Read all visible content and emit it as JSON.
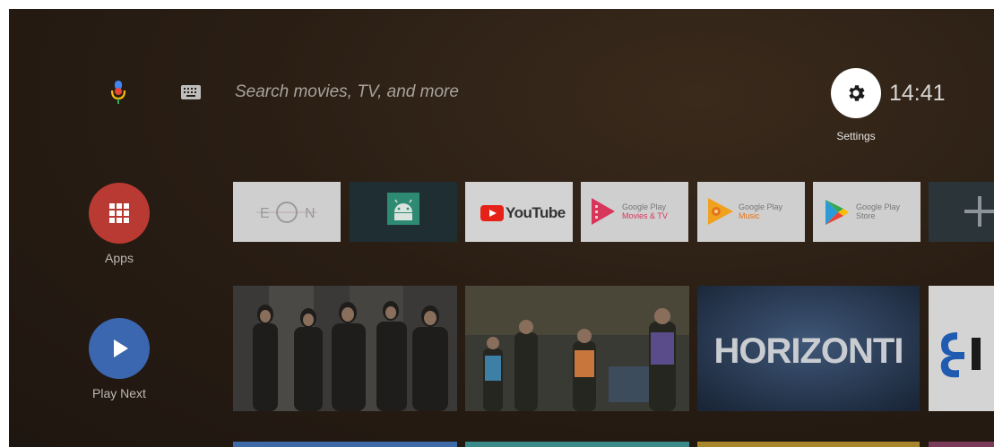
{
  "search": {
    "placeholder": "Search movies, TV, and more"
  },
  "header": {
    "settings_label": "Settings",
    "clock": "14:41"
  },
  "sidebar": {
    "apps_label": "Apps",
    "play_next_label": "Play Next"
  },
  "apps_row": {
    "tiles": [
      {
        "name": "EON",
        "logo_text": "E O N"
      },
      {
        "name": "Android"
      },
      {
        "name": "YouTube",
        "logo_text": "YouTube"
      },
      {
        "name": "Google Play Movies & TV",
        "line1": "Google Play",
        "line2": "Movies & TV"
      },
      {
        "name": "Google Play Music",
        "line1": "Google Play",
        "line2": "Music"
      },
      {
        "name": "Google Play Store",
        "line1": "Google Play",
        "line2": "Store"
      },
      {
        "name": "Add"
      }
    ]
  },
  "media_row": {
    "items": [
      {
        "name": "show-cast"
      },
      {
        "name": "family-sitcom"
      },
      {
        "name": "horizonti",
        "title": "HORIZONTI"
      },
      {
        "name": "euroleague"
      }
    ]
  },
  "colors": {
    "accent_red": "#b83a32",
    "accent_blue": "#3b66b0",
    "youtube_red": "#e62117",
    "background": "#2a1e14"
  }
}
